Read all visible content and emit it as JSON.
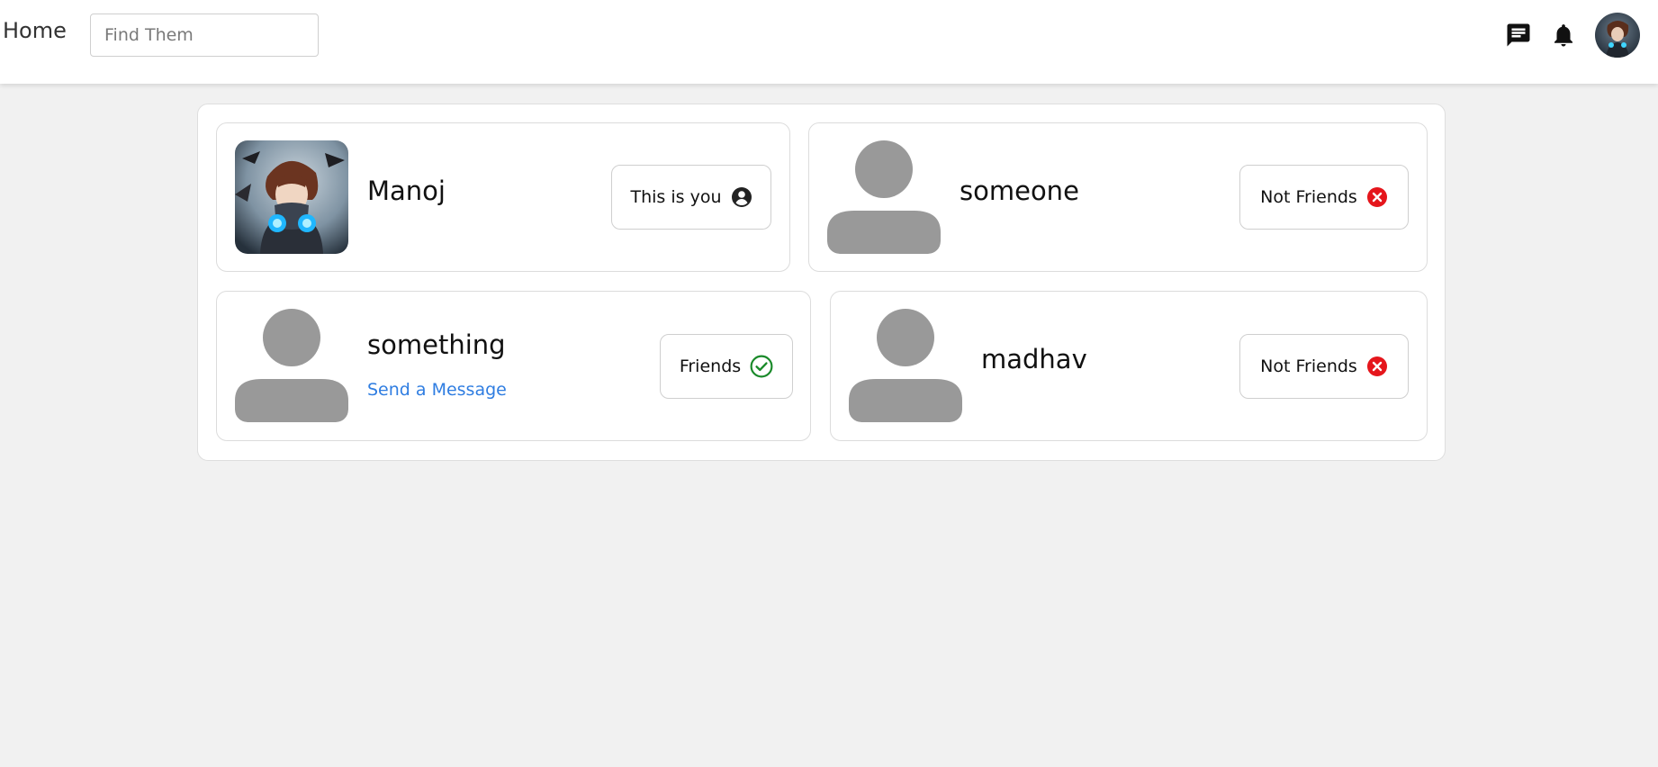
{
  "nav": {
    "home_label": "Home",
    "search_placeholder": "Find Them",
    "icons": [
      "message-icon",
      "bell-icon"
    ]
  },
  "users": [
    {
      "name": "Manoj",
      "avatar": "photo",
      "status_label": "This is you",
      "status_icon": "account-circle-icon"
    },
    {
      "name": "someone",
      "avatar": "placeholder",
      "status_label": "Not Friends",
      "status_icon": "cancel-icon"
    },
    {
      "name": "something",
      "avatar": "placeholder",
      "status_label": "Friends",
      "status_icon": "check-circle-icon",
      "link_label": "Send a Message"
    },
    {
      "name": "madhav",
      "avatar": "placeholder",
      "status_label": "Not Friends",
      "status_icon": "cancel-icon"
    }
  ],
  "colors": {
    "friends_green": "#1a8a2a",
    "not_friends_red": "#e5161c",
    "link_blue": "#2f7de1",
    "placeholder_gray": "#999999"
  }
}
